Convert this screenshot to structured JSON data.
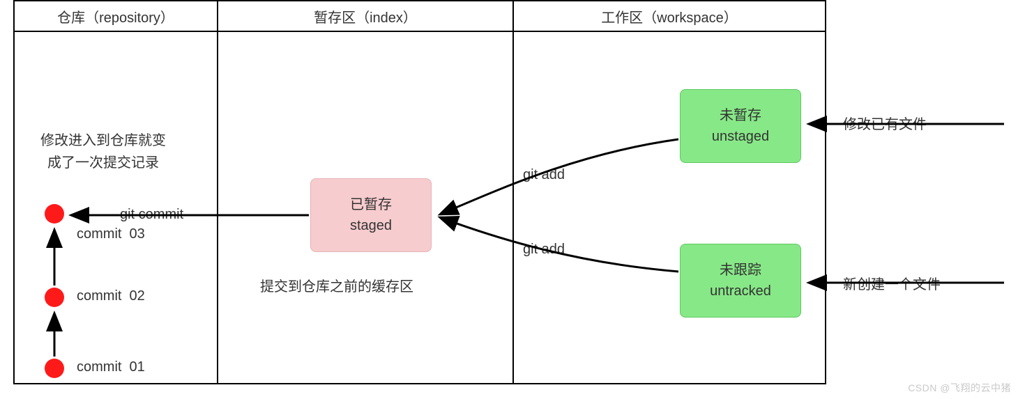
{
  "columns": {
    "repository": {
      "title": "仓库（repository）"
    },
    "index": {
      "title": "暂存区（index）"
    },
    "workspace": {
      "title": "工作区（workspace）"
    }
  },
  "repository": {
    "note_line1": "修改进入到仓库就变",
    "note_line2": "成了一次提交记录",
    "commits": [
      {
        "label": "commit  03"
      },
      {
        "label": "commit  02"
      },
      {
        "label": "commit  01"
      }
    ]
  },
  "index": {
    "staged_cn": "已暂存",
    "staged_en": "staged",
    "caption": "提交到仓库之前的缓存区"
  },
  "workspace": {
    "unstaged_cn": "未暂存",
    "unstaged_en": "unstaged",
    "untracked_cn": "未跟踪",
    "untracked_en": "untracked"
  },
  "arrows": {
    "git_commit": "git commit",
    "git_add_top": "git add",
    "git_add_bottom": "git add",
    "modify_file": "修改已有文件",
    "new_file": "新创建一个文件"
  },
  "watermark": "CSDN @飞翔的云中猪"
}
